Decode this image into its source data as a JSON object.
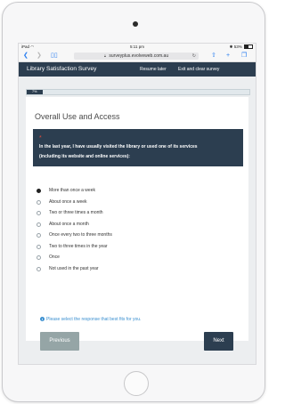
{
  "status_bar": {
    "device": "iPad",
    "time": "5:11 pm",
    "battery": "53%"
  },
  "browser": {
    "url": "surveyplus.evolveweb.com.au",
    "icons": [
      "back-icon",
      "forward-icon",
      "bookmarks-icon",
      "lock-icon",
      "reload-icon",
      "share-icon",
      "new-tab-icon",
      "tabs-icon"
    ]
  },
  "header": {
    "title": "Library Satisfaction Survey",
    "resume_label": "Resume later",
    "exit_label": "Exit and clear survey"
  },
  "progress": {
    "label": "7%",
    "value": 0.07
  },
  "section": {
    "title": "Overall Use and Access"
  },
  "question": {
    "required_mark": "*",
    "line1": "In the last year, I have usually visited the library or used one of its services",
    "line2": "(including its website and online services):"
  },
  "options": [
    {
      "label": "More than once a week",
      "selected": true
    },
    {
      "label": "About once a week",
      "selected": false
    },
    {
      "label": "Two or three times a month",
      "selected": false
    },
    {
      "label": "About once a month",
      "selected": false
    },
    {
      "label": "Once every two to three months",
      "selected": false
    },
    {
      "label": "Two to three times in the year",
      "selected": false
    },
    {
      "label": "Once",
      "selected": false
    },
    {
      "label": "Not used in the past year",
      "selected": false
    }
  ],
  "hint": {
    "icon": "info-icon",
    "text": "Please select the response that best fits for you."
  },
  "navigation": {
    "previous_label": "Previous",
    "next_label": "Next"
  },
  "colors": {
    "header_bg": "#2c3e50",
    "previous_bg": "#95a5a6",
    "hint": "#3a8fd0",
    "required": "#e74c3c"
  }
}
